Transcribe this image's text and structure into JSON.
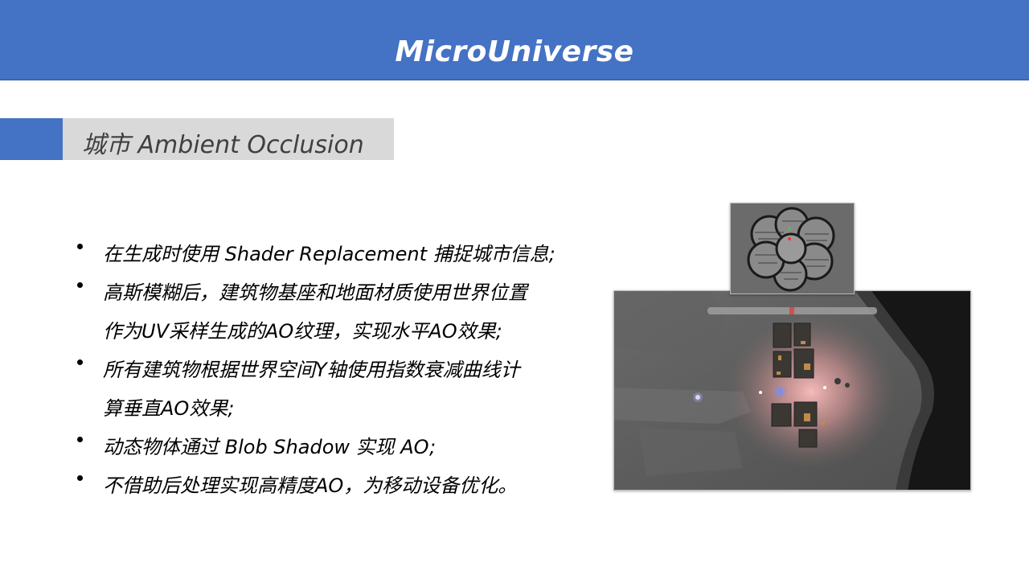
{
  "header": {
    "title": "MicroUniverse"
  },
  "section": {
    "title": "城市 Ambient Occlusion"
  },
  "bullets": [
    {
      "lines": [
        "在生成时使用 Shader Replacement 捕捉城市信息;"
      ]
    },
    {
      "lines": [
        "高斯模糊后，建筑物基座和地面材质使用世界位置",
        "作为UV采样生成的AO纹理，实现水平AO效果;"
      ]
    },
    {
      "lines": [
        "所有建筑物根据世界空间Y轴使用指数衰减曲线计",
        "算垂直AO效果;"
      ]
    },
    {
      "lines": [
        "动态物体通过 Blob Shadow 实现 AO;"
      ]
    },
    {
      "lines": [
        "不借助后处理实现高精度AO，为移动设备优化。"
      ]
    }
  ],
  "colors": {
    "accent": "#4472c4",
    "section_bg": "#d9d9d9",
    "glow": "#ffb0b0"
  }
}
